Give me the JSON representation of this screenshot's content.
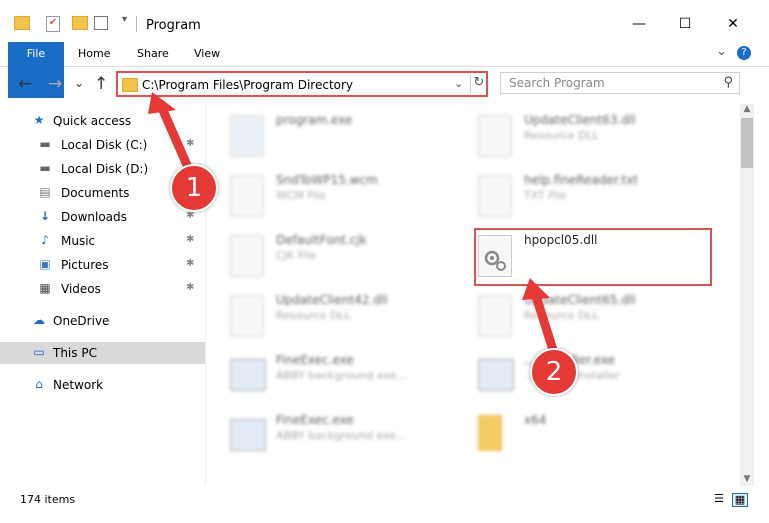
{
  "window": {
    "title": "Program",
    "controls": [
      "—",
      "☐",
      "✕"
    ]
  },
  "ribbon": {
    "tabs": [
      "File",
      "Home",
      "Share",
      "View"
    ],
    "help_icon": "?",
    "expand_icon": "⌄"
  },
  "nav": {
    "back": "←",
    "forward": "→",
    "recent": "⌄",
    "up": "↑"
  },
  "address": {
    "path": "C:\\Program Files\\Program Directory",
    "dropdown": "⌄",
    "refresh": "↻"
  },
  "search": {
    "placeholder": "Search Program",
    "icon": "⚲"
  },
  "sidebar": {
    "items": [
      {
        "label": "Quick access",
        "icon": "★",
        "pinned": false
      },
      {
        "label": "Local Disk (C:)",
        "icon": "▬",
        "pinned": true
      },
      {
        "label": "Local Disk (D:)",
        "icon": "▬",
        "pinned": false
      },
      {
        "label": "Documents",
        "icon": "▤",
        "pinned": true
      },
      {
        "label": "Downloads",
        "icon": "↓",
        "pinned": true
      },
      {
        "label": "Music",
        "icon": "♪",
        "pinned": true
      },
      {
        "label": "Pictures",
        "icon": "▣",
        "pinned": true
      },
      {
        "label": "Videos",
        "icon": "▦",
        "pinned": true
      },
      {
        "label": "OneDrive",
        "icon": "☁",
        "pinned": false
      },
      {
        "label": "This PC",
        "icon": "▭",
        "pinned": false
      },
      {
        "label": "Network",
        "icon": "⌂",
        "pinned": false
      }
    ],
    "pin_icon": "✱"
  },
  "files": [
    {
      "name": "program.exe",
      "type": ""
    },
    {
      "name": "UpdateClient63.dll",
      "type": "Resource DLL"
    },
    {
      "name": "SndToWP15.wcm",
      "type": "WCM File"
    },
    {
      "name": "help.fineReader.txt",
      "type": "TXT File"
    },
    {
      "name": "DefaultFont.cjk",
      "type": "CJK File"
    },
    {
      "name": "hpopcl05.dll",
      "type": ""
    },
    {
      "name": "UpdateClient42.dll",
      "type": "Resource DLL"
    },
    {
      "name": "UpdateClient65.dll",
      "type": "Resource DLL"
    },
    {
      "name": "FineExec.exe",
      "type": "ABBY background exe..."
    },
    {
      "name": "...einstaller.exe",
      "type": "...pdatec installer"
    },
    {
      "name": "FineExec.exe",
      "type": "ABBY background exe..."
    },
    {
      "name": "x64",
      "type": ""
    }
  ],
  "annotations": {
    "badge1": "1",
    "badge2": "2"
  },
  "status": {
    "item_count": "174 items"
  },
  "colors": {
    "accent": "#1a6dc7",
    "highlight": "#d9534f",
    "badge": "#e53935"
  }
}
